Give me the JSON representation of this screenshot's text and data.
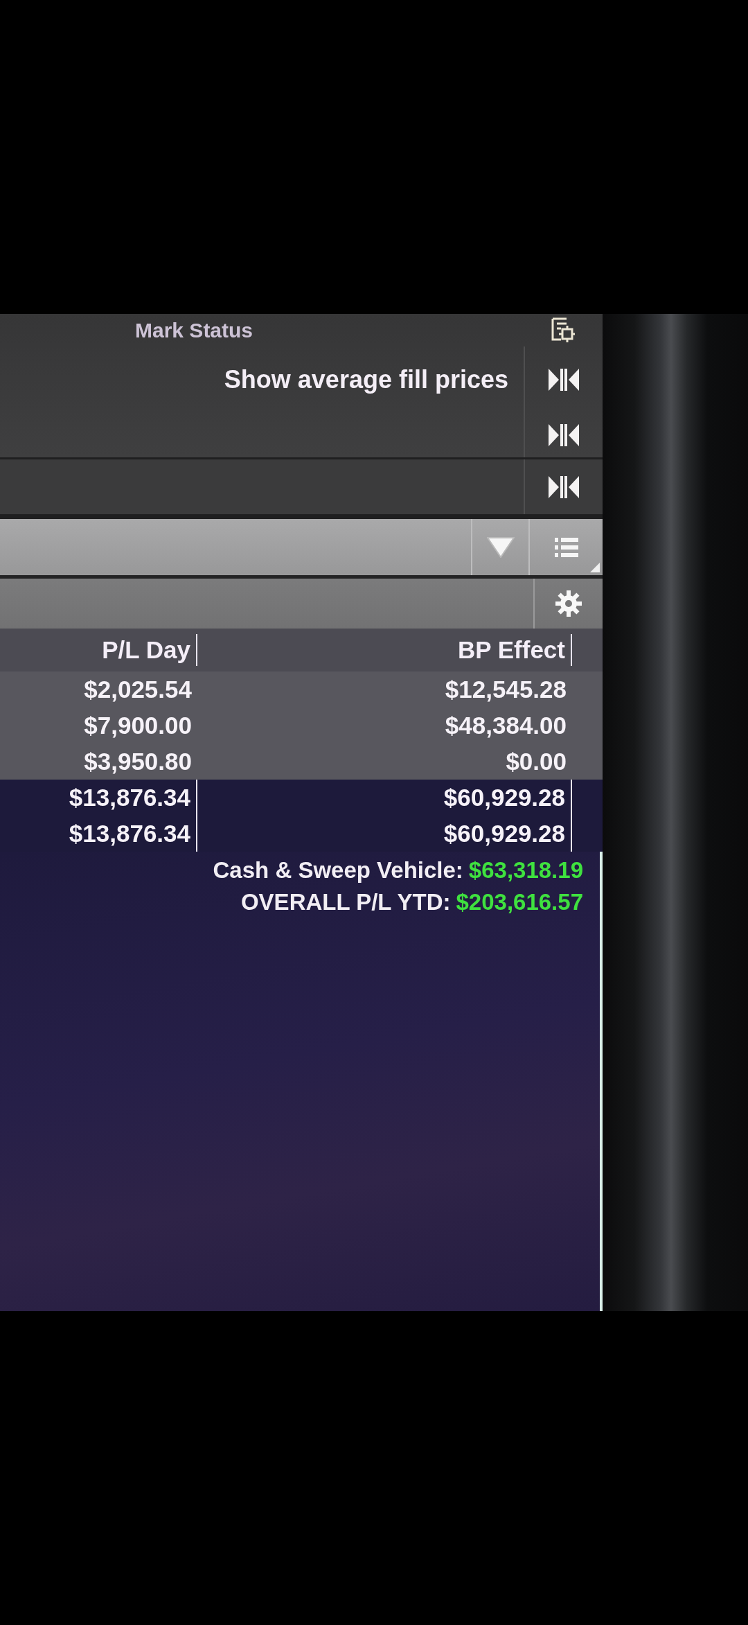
{
  "panel_header": {
    "label": "Mark Status"
  },
  "settings": {
    "option_label": "Show average fill prices"
  },
  "table": {
    "columns": [
      "P/L Day",
      "BP Effect"
    ],
    "rows": [
      {
        "kind": "position",
        "cells": [
          "$2,025.54",
          "$12,545.28"
        ]
      },
      {
        "kind": "position",
        "cells": [
          "$7,900.00",
          "$48,384.00"
        ]
      },
      {
        "kind": "position",
        "cells": [
          "$3,950.80",
          "$0.00"
        ]
      },
      {
        "kind": "total",
        "cells": [
          "$13,876.34",
          "$60,929.28"
        ]
      },
      {
        "kind": "total",
        "cells": [
          "$13,876.34",
          "$60,929.28"
        ]
      }
    ]
  },
  "summary": [
    {
      "label": "Cash & Sweep Vehicle:",
      "value": "$63,318.19"
    },
    {
      "label": "OVERALL P/L YTD:",
      "value": "$203,616.57"
    }
  ]
}
